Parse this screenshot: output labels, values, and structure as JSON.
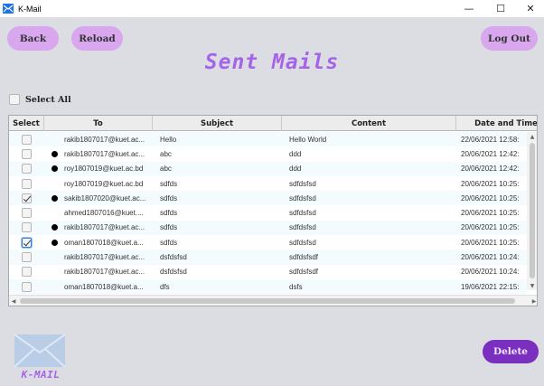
{
  "window": {
    "title": "K-Mail",
    "minimize_glyph": "—",
    "maximize_glyph": "☐",
    "close_glyph": "✕"
  },
  "toolbar": {
    "back_label": "Back",
    "reload_label": "Reload",
    "logout_label": "Log Out"
  },
  "page_title": "Sent Mails",
  "select_all": {
    "label": "Select All",
    "checked": false
  },
  "table": {
    "columns": [
      "Select",
      "To",
      "Subject",
      "Content",
      "Date and Time"
    ],
    "rows": [
      {
        "checked": false,
        "focused": false,
        "unread": false,
        "to": "rakib1807017@kuet.ac...",
        "subject": "Hello",
        "content": "Hello World",
        "date": "22/06/2021 12:58:"
      },
      {
        "checked": false,
        "focused": false,
        "unread": true,
        "to": "rakib1807017@kuet.ac...",
        "subject": "abc",
        "content": "ddd",
        "date": "20/06/2021 12:42:"
      },
      {
        "checked": false,
        "focused": false,
        "unread": true,
        "to": "roy1807019@kuet.ac.bd",
        "subject": "abc",
        "content": "ddd",
        "date": "20/06/2021 12:42:"
      },
      {
        "checked": false,
        "focused": false,
        "unread": false,
        "to": "roy1807019@kuet.ac.bd",
        "subject": "sdfds",
        "content": "sdfdsfsd",
        "date": "20/06/2021 10:25:"
      },
      {
        "checked": true,
        "focused": false,
        "unread": true,
        "to": "sakib1807020@kuet.ac...",
        "subject": "sdfds",
        "content": "sdfdsfsd",
        "date": "20/06/2021 10:25:"
      },
      {
        "checked": false,
        "focused": false,
        "unread": false,
        "to": "ahmed1807016@kuet....",
        "subject": "sdfds",
        "content": "sdfdsfsd",
        "date": "20/06/2021 10:25:"
      },
      {
        "checked": false,
        "focused": false,
        "unread": true,
        "to": "rakib1807017@kuet.ac...",
        "subject": "sdfds",
        "content": "sdfdsfsd",
        "date": "20/06/2021 10:25:"
      },
      {
        "checked": true,
        "focused": true,
        "unread": true,
        "to": "oman1807018@kuet.a...",
        "subject": "sdfds",
        "content": "sdfdsfsd",
        "date": "20/06/2021 10:25:"
      },
      {
        "checked": false,
        "focused": false,
        "unread": false,
        "to": "rakib1807017@kuet.ac...",
        "subject": "dsfdsfsd",
        "content": "sdfdsfsdf",
        "date": "20/06/2021 10:24:"
      },
      {
        "checked": false,
        "focused": false,
        "unread": false,
        "to": "rakib1807017@kuet.ac...",
        "subject": "dsfdsfsd",
        "content": "sdfdsfsdf",
        "date": "20/06/2021 10:24:"
      },
      {
        "checked": false,
        "focused": false,
        "unread": false,
        "to": "oman1807018@kuet.a...",
        "subject": "dfs",
        "content": "dsfs",
        "date": "19/06/2021 22:15:"
      }
    ]
  },
  "actions": {
    "delete_label": "Delete"
  },
  "logo": {
    "text": "K-MAIL"
  },
  "colors": {
    "accent": "#a463e8",
    "pill_button": "#d9a7ee",
    "delete_button": "#7b2fbf",
    "background": "#dbdde3"
  }
}
